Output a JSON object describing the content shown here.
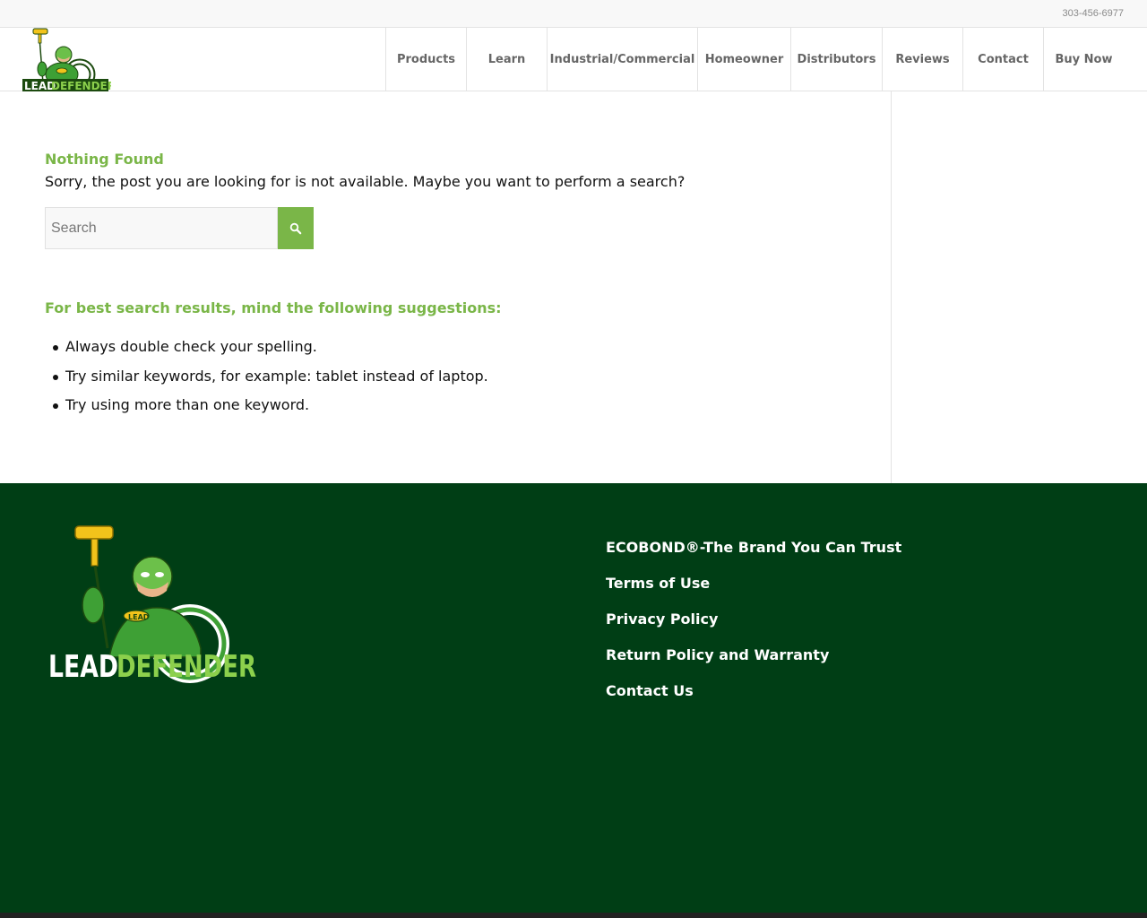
{
  "topbar": {
    "phone": "303-456-6977"
  },
  "brand": {
    "logo_text_lead": "LEAD",
    "logo_text_defender": "DEFENDER",
    "badge_text": "LEAD"
  },
  "nav": {
    "items": [
      {
        "label": "Products",
        "width": 90
      },
      {
        "label": "Learn",
        "width": 90
      },
      {
        "label": "Industrial/Commercial",
        "width": 168
      },
      {
        "label": "Homeowner",
        "width": 104
      },
      {
        "label": "Distributors",
        "width": 102
      },
      {
        "label": "Reviews",
        "width": 90
      },
      {
        "label": "Contact",
        "width": 90
      },
      {
        "label": "Buy Now",
        "width": 90
      }
    ]
  },
  "main": {
    "heading": "Nothing Found",
    "message": "Sorry, the post you are looking for is not available. Maybe you want to perform a search?",
    "search": {
      "placeholder": "Search"
    },
    "suggestions_title": "For best search results, mind the following suggestions:",
    "suggestions": [
      "Always double check your spelling.",
      "Try similar keywords, for example: tablet instead of laptop.",
      "Try using more than one keyword."
    ]
  },
  "footer": {
    "links": [
      "ECOBOND®-The Brand You Can Trust",
      "Terms of Use",
      "Privacy Policy",
      "Return Policy and Warranty",
      "Contact Us"
    ]
  },
  "icons": {
    "search": "search-icon"
  },
  "colors": {
    "accent": "#7ab648",
    "footer_bg": "#003e15"
  }
}
